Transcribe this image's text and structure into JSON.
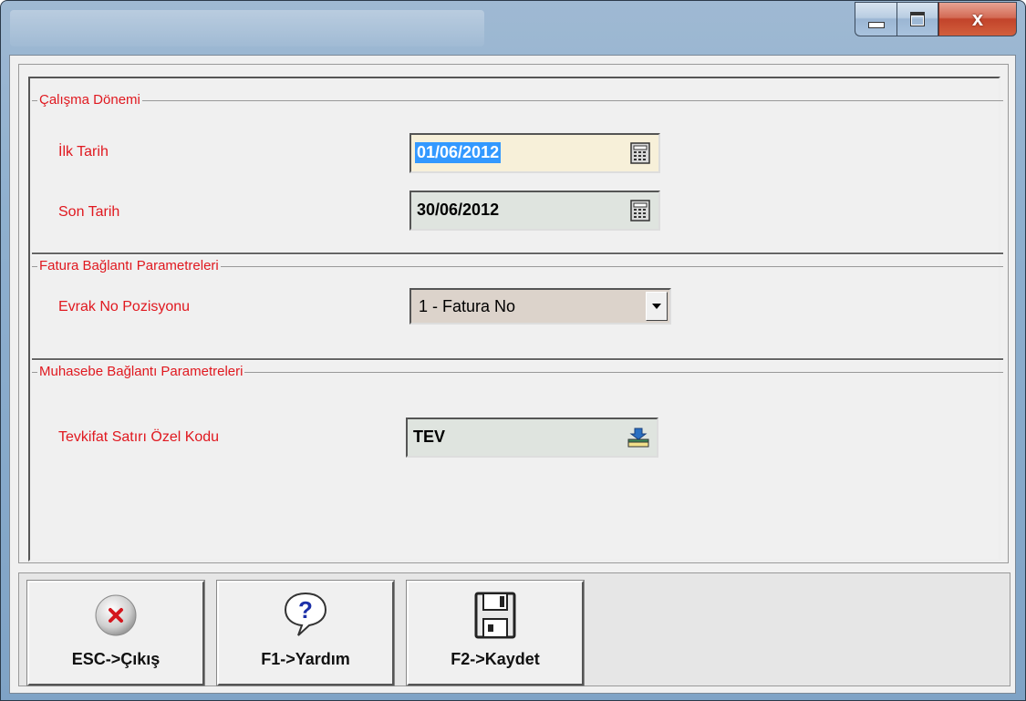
{
  "window": {
    "caption_buttons": [
      "minimize",
      "maximize",
      "close"
    ],
    "close_glyph": "x"
  },
  "groups": {
    "work_period": {
      "title": "Çalışma Dönemi",
      "start_label": "İlk Tarih",
      "start_value": "01/06/2012",
      "end_label": "Son Tarih",
      "end_value": "30/06/2012"
    },
    "invoice_params": {
      "title": "Fatura Bağlantı Parametreleri",
      "doc_no_label": "Evrak No Pozisyonu",
      "doc_no_value": "1 - Fatura No"
    },
    "accounting_params": {
      "title": "Muhasebe Bağlantı Parametreleri",
      "special_code_label": "Tevkifat Satırı Özel Kodu",
      "special_code_value": "TEV"
    }
  },
  "toolbar": {
    "exit_label": "ESC->Çıkış",
    "help_label": "F1->Yardım",
    "save_label": "F2->Kaydet"
  },
  "colors": {
    "label_red": "#e0181f",
    "start_date_bg": "#f7f0d9",
    "end_date_bg": "#dfe4df",
    "combo_bg": "#dcd3cb",
    "selection_blue": "#3399ff"
  },
  "icons": {
    "exit": "x-circle-icon",
    "help": "question-balloon-icon",
    "save": "floppy-disk-icon",
    "calendar": "calendar-icon",
    "lookup": "lookup-icon",
    "dropdown": "chevron-down-icon"
  }
}
